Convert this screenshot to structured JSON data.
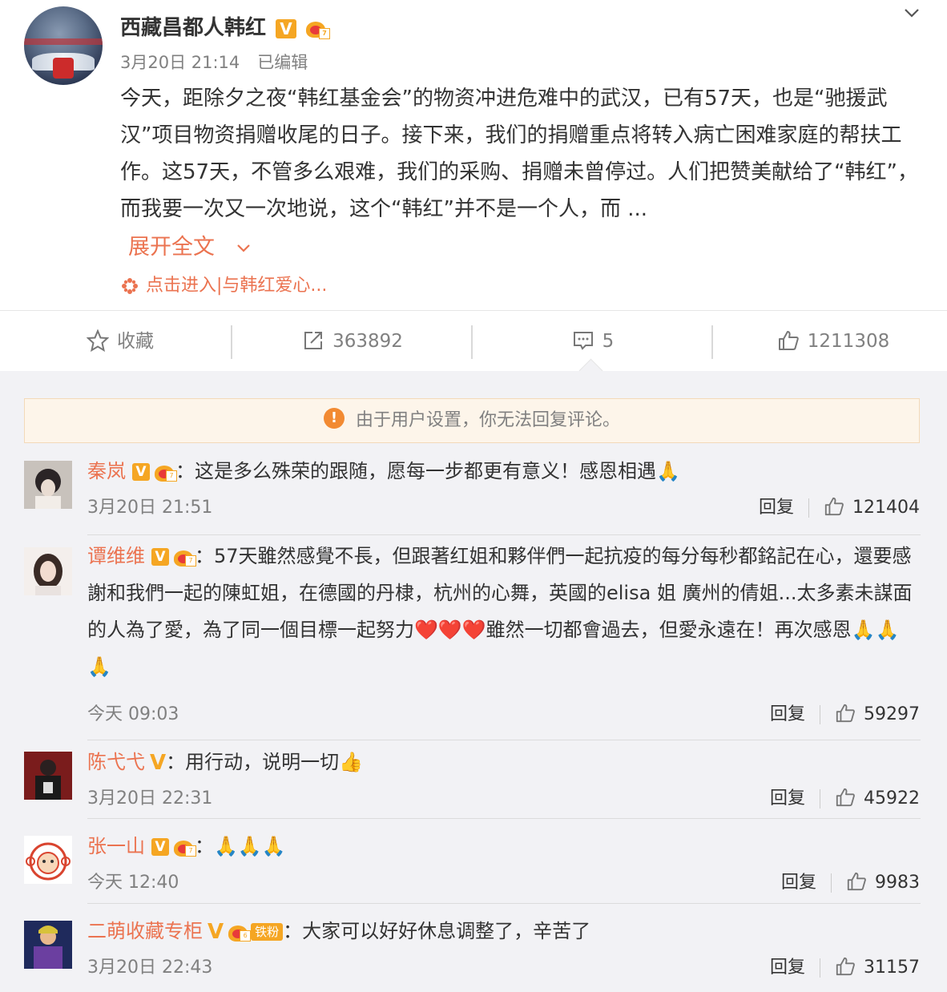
{
  "post": {
    "author": "西藏昌都人韩红",
    "time": "3月20日 21:14",
    "edited": "已编辑",
    "text": "今天，距除夕之夜“韩红基金会”的物资冲进危难中的武汉，已有57天，也是“驰援武汉”项目物资捐赠收尾的日子。接下来，我们的捐赠重点将转入病亡困难家庭的帮扶工作。这57天，不管多么艰难，我们的采购、捐赠未曾停过。人们把赞美献给了“韩红”，而我要一次又一次地说，这个“韩红”并不是一个人，而 ...",
    "expand_label": "展开全文",
    "topic_link": "点击进入|与韩红爱心..."
  },
  "actions": {
    "favorite_label": "收藏",
    "repost_count": "363892",
    "comment_count": "5",
    "like_count": "1211308"
  },
  "notice": "由于用户设置，你无法回复评论。",
  "comments": [
    {
      "name": "秦岚",
      "text": "：这是多么殊荣的跟随，愿每一步都更有意义！感恩相遇🙏",
      "time": "3月20日 21:51",
      "reply": "回复",
      "likes": "121404"
    },
    {
      "name": "谭维维",
      "text": "：57天雖然感覺不長，但跟著红姐和夥伴們一起抗疫的每分每秒都銘記在心，還要感謝和我們一起的陳虹姐，在德國的丹棣，杭州的心舞，英國的elisa 姐 廣州的倩姐...太多素未謀面的人為了愛，為了同一個目標一起努力❤️❤️❤️雖然一切都會過去，但愛永遠在！再次感恩🙏🙏🙏",
      "time": "今天 09:03",
      "reply": "回复",
      "likes": "59297"
    },
    {
      "name": "陈弋弋",
      "text": "：用行动，说明一切👍",
      "time": "3月20日 22:31",
      "reply": "回复",
      "likes": "45922"
    },
    {
      "name": "张一山",
      "text": "：🙏🙏🙏",
      "time": "今天 12:40",
      "reply": "回复",
      "likes": "9983"
    },
    {
      "name": "二萌收藏专柜",
      "fan_tag": "铁粉",
      "text": "：大家可以好好休息调整了，辛苦了",
      "time": "3月20日 22:43",
      "reply": "回复",
      "likes": "31157"
    }
  ],
  "colors": {
    "accent": "#eb7350",
    "vip": "#f5a623",
    "muted": "#808080"
  },
  "icons": [
    "chevron-down-icon",
    "star-icon",
    "repost-icon",
    "comment-icon",
    "like-icon",
    "warning-icon",
    "flower-icon",
    "crown-icon",
    "verified-icon"
  ]
}
